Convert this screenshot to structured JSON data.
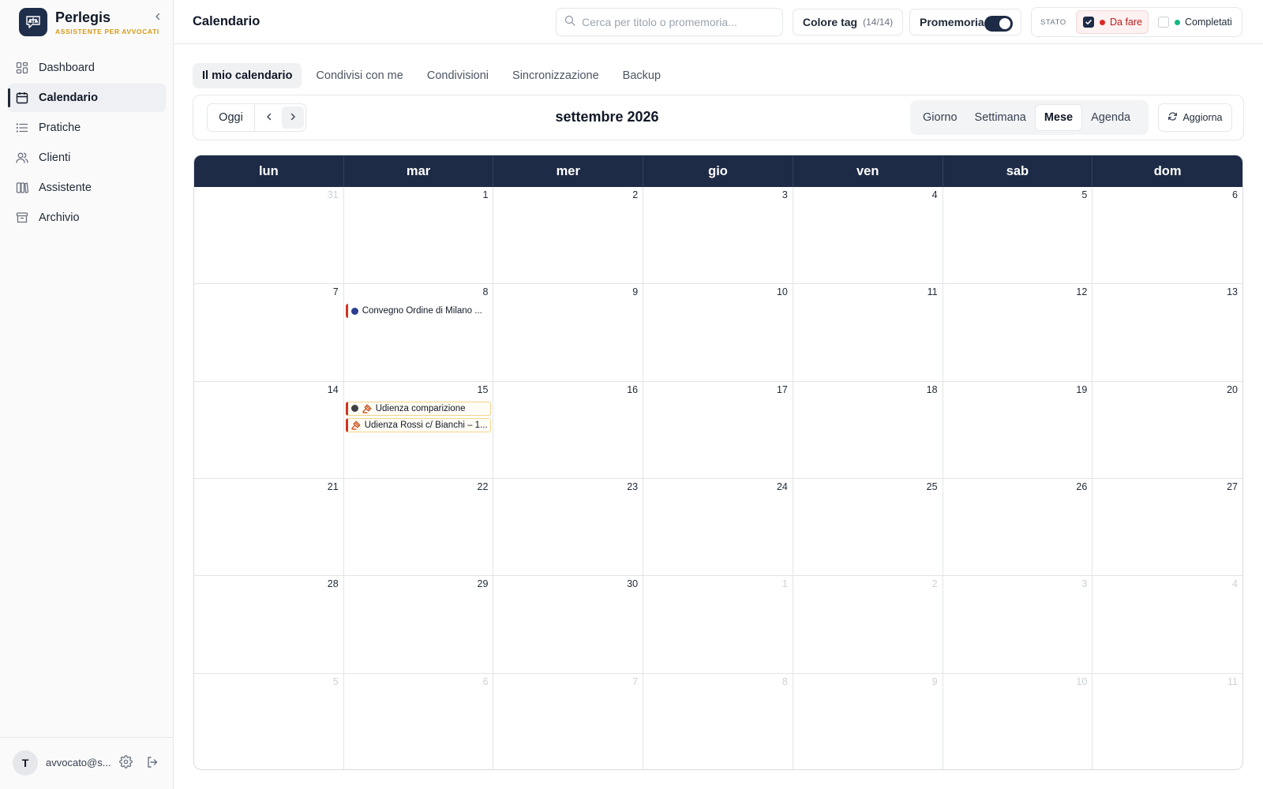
{
  "brand": {
    "name": "Perlegis",
    "subtitle": "ASSISTENTE PER AVVOCATI"
  },
  "sidebar": {
    "items": [
      {
        "key": "dashboard",
        "label": "Dashboard",
        "active": false
      },
      {
        "key": "calendar",
        "label": "Calendario",
        "active": true
      },
      {
        "key": "cases",
        "label": "Pratiche",
        "active": false
      },
      {
        "key": "clients",
        "label": "Clienti",
        "active": false
      },
      {
        "key": "assistant",
        "label": "Assistente",
        "active": false
      },
      {
        "key": "archive",
        "label": "Archivio",
        "active": false
      }
    ],
    "user": {
      "initial": "T",
      "email": "avvocato@s..."
    }
  },
  "header": {
    "title": "Calendario",
    "search_placeholder": "Cerca per titolo o promemoria...",
    "tag_color_label": "Colore tag",
    "tag_color_count": "(14/14)",
    "reminder_label": "Promemoria",
    "reminder_enabled": true,
    "status_label": "STATO",
    "status_todo": {
      "label": "Da fare",
      "checked": true,
      "color": "#dc2626"
    },
    "status_done": {
      "label": "Completati",
      "checked": false,
      "color": "#10b981"
    }
  },
  "tabs": [
    {
      "label": "Il mio calendario",
      "active": true
    },
    {
      "label": "Condivisi con me",
      "active": false
    },
    {
      "label": "Condivisioni",
      "active": false
    },
    {
      "label": "Sincronizzazione",
      "active": false
    },
    {
      "label": "Backup",
      "active": false
    }
  ],
  "toolbar": {
    "today_label": "Oggi",
    "month_title": "settembre 2026",
    "views": [
      {
        "label": "Giorno",
        "active": false
      },
      {
        "label": "Settimana",
        "active": false
      },
      {
        "label": "Mese",
        "active": true
      },
      {
        "label": "Agenda",
        "active": false
      }
    ],
    "refresh_label": "Aggiorna"
  },
  "calendar": {
    "weekdays": [
      "lun",
      "mar",
      "mer",
      "gio",
      "ven",
      "sab",
      "dom"
    ],
    "days": [
      {
        "n": "31",
        "muted": true
      },
      {
        "n": "1"
      },
      {
        "n": "2"
      },
      {
        "n": "3"
      },
      {
        "n": "4"
      },
      {
        "n": "5"
      },
      {
        "n": "6"
      },
      {
        "n": "7"
      },
      {
        "n": "8",
        "events": [
          {
            "title": "Convegno Ordine di Milano ...",
            "dot": "#2b3d8f",
            "gavel": false,
            "boxed": false
          }
        ]
      },
      {
        "n": "9"
      },
      {
        "n": "10"
      },
      {
        "n": "11"
      },
      {
        "n": "12"
      },
      {
        "n": "13"
      },
      {
        "n": "14"
      },
      {
        "n": "15",
        "events": [
          {
            "title": "Udienza comparizione",
            "dot": "#3f3f46",
            "gavel": true,
            "boxed": true
          },
          {
            "title": "Udienza Rossi c/ Bianchi – 1...",
            "dot": null,
            "gavel": true,
            "boxed": true
          }
        ]
      },
      {
        "n": "16"
      },
      {
        "n": "17"
      },
      {
        "n": "18"
      },
      {
        "n": "19"
      },
      {
        "n": "20"
      },
      {
        "n": "21"
      },
      {
        "n": "22"
      },
      {
        "n": "23"
      },
      {
        "n": "24"
      },
      {
        "n": "25"
      },
      {
        "n": "26"
      },
      {
        "n": "27"
      },
      {
        "n": "28"
      },
      {
        "n": "29"
      },
      {
        "n": "30"
      },
      {
        "n": "1",
        "muted": true
      },
      {
        "n": "2",
        "muted": true
      },
      {
        "n": "3",
        "muted": true
      },
      {
        "n": "4",
        "muted": true
      },
      {
        "n": "5",
        "muted": true
      },
      {
        "n": "6",
        "muted": true
      },
      {
        "n": "7",
        "muted": true
      },
      {
        "n": "8",
        "muted": true
      },
      {
        "n": "9",
        "muted": true
      },
      {
        "n": "10",
        "muted": true
      },
      {
        "n": "11",
        "muted": true
      }
    ]
  },
  "colors": {
    "accent": "#1e2b46",
    "event_bar": "#d4321e",
    "brand_sub": "#d79a18"
  }
}
